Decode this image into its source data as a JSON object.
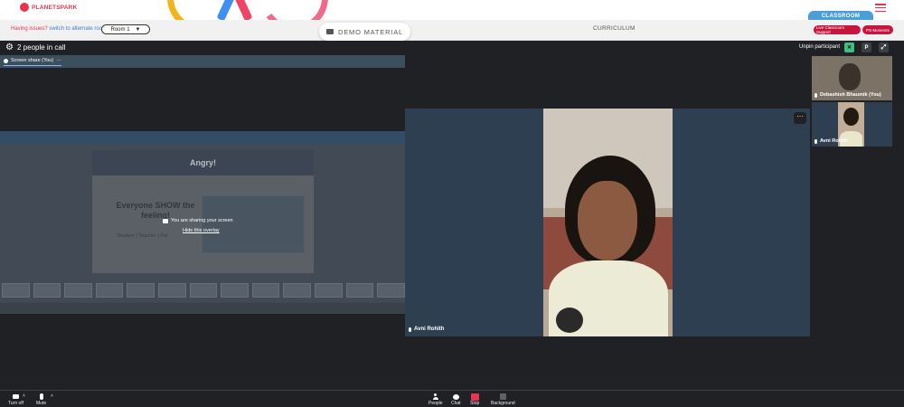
{
  "app": {
    "logo_text": "PLANETSPARK",
    "issue_text": "Having issues?",
    "issue_link": "switch to alternate room",
    "room_select_value": "Room 1",
    "demo_material_label": "DEMO MATERIAL",
    "curriculum_label": "CURRICULUM",
    "classroom_tab_label": "CLASSROOM",
    "live_support_label": "Live Classroom Support",
    "moments_label": "PS Moments"
  },
  "meet": {
    "people_count": "2 people in call",
    "unpin_label": "Unpin participant",
    "p_button": "P",
    "screen_share_tab": "Screen share (You)",
    "tab_more": "···",
    "sharing_message": "You are sharing your screen",
    "hide_overlay": "Hide this overlay",
    "shared_slide": {
      "title": "Angry!",
      "body": "Everyone SHOW the feeling!",
      "roles": "Student | Teacher | Par"
    },
    "main_participant": "Avni Rohith",
    "more_options": "···",
    "tiles": [
      {
        "name": "Debashish Bhaumik (You)"
      },
      {
        "name": "Avni Rohith"
      }
    ]
  },
  "controls": {
    "turn_off": "Turn off",
    "mute": "Mute",
    "people": "People",
    "chat": "Chat",
    "stop": "Stop",
    "background": "Background"
  },
  "colors": {
    "brand_red": "#e8344e",
    "meet_dark": "#202124",
    "video_bg": "#2e3f52",
    "classroom_blue": "#4a9fd6",
    "pill_red": "#c4163f"
  }
}
